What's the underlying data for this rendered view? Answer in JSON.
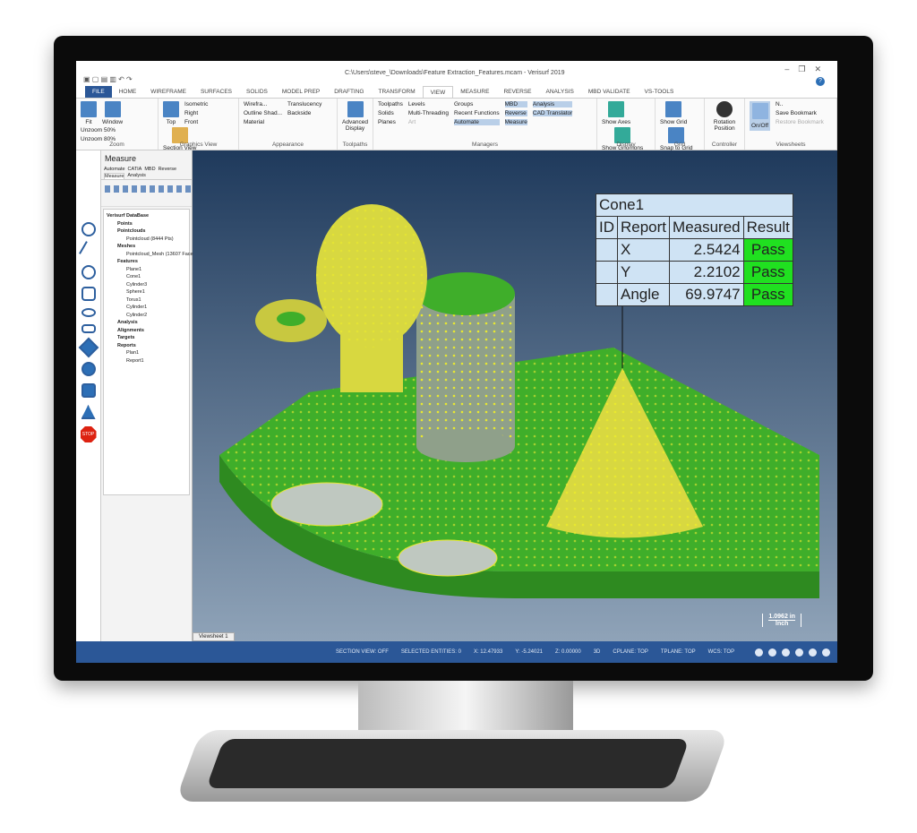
{
  "window": {
    "title": "C:\\Users\\steve_\\Downloads\\Feature Extraction_Features.mcam - Verisurf 2019",
    "controls": [
      "–",
      "❐",
      "✕"
    ],
    "help": "?"
  },
  "tabs": [
    "FILE",
    "HOME",
    "WIREFRAME",
    "SURFACES",
    "SOLIDS",
    "MODEL PREP",
    "DRAFTING",
    "TRANSFORM",
    "VIEW",
    "MEASURE",
    "REVERSE",
    "ANALYSIS",
    "MBD VALIDATE",
    "VS-TOOLS"
  ],
  "active_tab": "VIEW",
  "ribbon": {
    "zoom": {
      "label": "Zoom",
      "fit": "Fit",
      "window": "Window",
      "unzoom50": "Unzoom 50%",
      "unzoom80": "Unzoom 80%"
    },
    "graphics_view": {
      "label": "Graphics View",
      "top": "Top",
      "isometric": "Isometric",
      "right": "Right",
      "front": "Front",
      "section_view": "Section View"
    },
    "appearance": {
      "label": "Appearance",
      "wireframe": "Wirefra...",
      "outline_shaded": "Outline Shad...",
      "material": "Material",
      "translucency": "Translucency",
      "backside": "Backside"
    },
    "toolpaths": {
      "label": "Toolpaths",
      "advanced_display": "Advanced Display"
    },
    "managers": {
      "label": "Managers",
      "items": [
        "Toolpaths",
        "Solids",
        "Planes",
        "Levels",
        "Multi-Threading",
        "Art",
        "Groups",
        "Recent Functions",
        "Automate",
        "MBD",
        "Reverse",
        "Measure",
        "Analysis",
        "CAD Translator"
      ]
    },
    "display": {
      "label": "Display",
      "show_axes": "Show Axes",
      "show_gnomons": "Show Gnomons"
    },
    "grid": {
      "label": "Grid",
      "show_grid": "Show Grid",
      "snap_to_grid": "Snap to Grid"
    },
    "controller": {
      "label": "Controller",
      "rotation_position": "Rotation Position"
    },
    "viewsheets": {
      "label": "Viewsheets",
      "on_off": "On/Off",
      "n": "N..",
      "save_bookmark": "Save Bookmark",
      "restore_bookmark": "Restore Bookmark"
    }
  },
  "panel": {
    "title": "Measure",
    "tabs": [
      "Automate",
      "CATIA",
      "MBD",
      "Reverse",
      "Measure",
      "Analysis"
    ],
    "active_tab": "Measure",
    "tree": [
      "Verisurf DataBase",
      "Points",
      "Pointclouds",
      "Pointcloud (8444 Pts)",
      "Meshes",
      "Pointcloud_Mesh (13607 Face",
      "Features",
      "Plane1",
      "Cone1",
      "Cylinder3",
      "Sphere1",
      "Torus1",
      "Cylinder1",
      "Cylinder2",
      "Analysis",
      "Alignments",
      "Targets",
      "Reports",
      "Plan1",
      "Report1"
    ]
  },
  "toolstrip": {
    "stop": "STOP"
  },
  "report_table": {
    "title": "Cone1",
    "headers": [
      "ID",
      "Report",
      "Measured",
      "Result"
    ],
    "rows": [
      [
        "",
        "X",
        "2.5424",
        "Pass"
      ],
      [
        "",
        "Y",
        "2.2102",
        "Pass"
      ],
      [
        "",
        "Angle",
        "69.9747",
        "Pass"
      ]
    ],
    "pass_color": "#20e020"
  },
  "viewsheet_tab": "Viewsheet 1",
  "scale": {
    "value": "1.0962 in",
    "unit": "Inch"
  },
  "status": {
    "section_view": "SECTION VIEW: OFF",
    "selected": "SELECTED ENTITIES: 0",
    "x": "X:  12.47933",
    "y": "Y:  -5.24021",
    "z": "Z:  0.00000",
    "mode": "3D",
    "cplane": "CPLANE: TOP",
    "tplane": "TPLANE: TOP",
    "wcs": "WCS: TOP"
  },
  "colors": {
    "accent": "#2b5797",
    "part": "#3fae2a",
    "points": "#e8e830"
  }
}
